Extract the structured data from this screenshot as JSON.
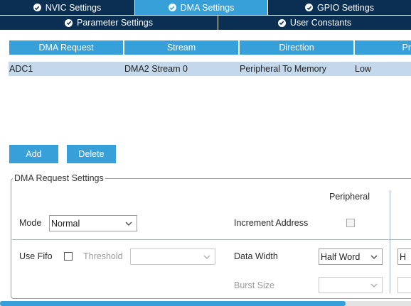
{
  "tabs_row1": [
    {
      "label": "NVIC Settings",
      "active": false
    },
    {
      "label": "DMA Settings",
      "active": true
    },
    {
      "label": "GPIO Settings",
      "active": false
    }
  ],
  "tabs_row2": [
    {
      "label": "Parameter Settings"
    },
    {
      "label": "User Constants"
    }
  ],
  "table": {
    "columns": [
      "DMA Request",
      "Stream",
      "Direction",
      "Pr"
    ],
    "rows": [
      [
        "ADC1",
        "DMA2 Stream 0",
        "Peripheral To Memory",
        "Low"
      ]
    ]
  },
  "buttons": {
    "add": "Add",
    "delete": "Delete"
  },
  "settings": {
    "legend": "DMA Request Settings",
    "peripheral_header": "Peripheral",
    "mode_label": "Mode",
    "mode_value": "Normal",
    "increment_label": "Increment Address",
    "use_fifo_label": "Use Fifo",
    "threshold_label": "Threshold",
    "threshold_value": "",
    "data_width_label": "Data Width",
    "data_width_value": "Half Word",
    "memory_data_width_value": "H",
    "burst_size_label": "Burst Size",
    "burst_size_value": ""
  },
  "icons": {
    "tab_check": "check-circle-icon",
    "dropdown": "chevron-down-icon"
  },
  "colors": {
    "tab_dark": "#0a2f52",
    "accent": "#38a0d8",
    "row_selected": "#c4d8ec"
  }
}
